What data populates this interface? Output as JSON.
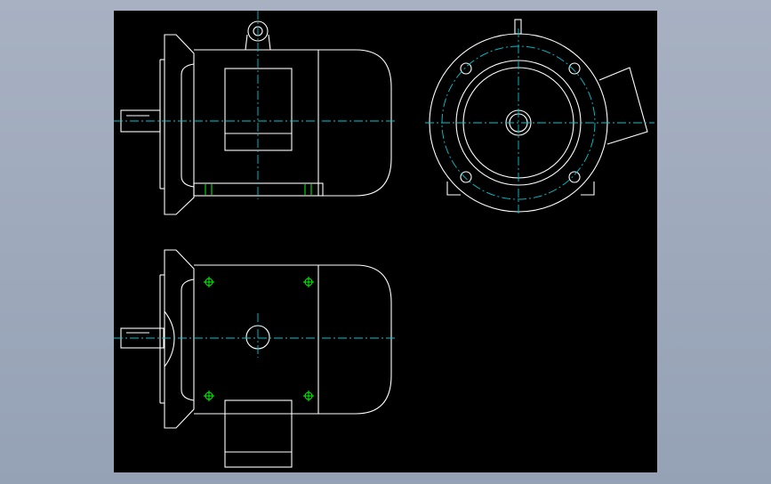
{
  "drawing": {
    "views": [
      {
        "id": "side-view",
        "type": "motor-side-elevation"
      },
      {
        "id": "front-view",
        "type": "motor-end-view"
      },
      {
        "id": "top-view",
        "type": "motor-plan-view"
      }
    ]
  },
  "colors": {
    "background": "#000000",
    "outline": "#ffffff",
    "centerline": "#00c8d2",
    "hole_marker": "#00ff00",
    "page_background": "#a7b1c2"
  },
  "icons": {
    "shaft_key": "key-icon",
    "lifting_eye": "eye-bolt-icon"
  }
}
